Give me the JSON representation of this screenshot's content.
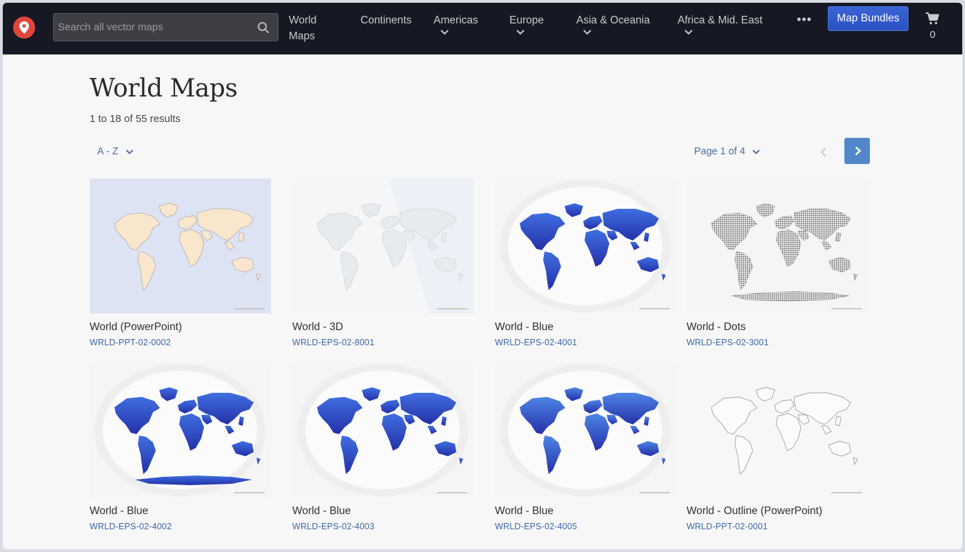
{
  "nav": {
    "search_placeholder": "Search all vector maps",
    "items": [
      {
        "label": "World\nMaps",
        "line1": "World",
        "line2": "Maps"
      },
      {
        "label": "Continents"
      },
      {
        "label": "Americas"
      },
      {
        "label": "Europe"
      },
      {
        "label": "Asia & Oceania"
      },
      {
        "label": "Africa & Mid. East"
      }
    ],
    "more": "•••",
    "bundles_label": "Map Bundles",
    "cart_count": "0"
  },
  "page": {
    "title": "World Maps",
    "results": "1 to 18 of 55 results",
    "sort_label": "A - Z",
    "page_label": "Page 1 of 4"
  },
  "products": [
    {
      "name": "World (PowerPoint)",
      "sku": "WRLD-PPT-02-0002",
      "style": "ppt"
    },
    {
      "name": "World - 3D",
      "sku": "WRLD-EPS-02-8001",
      "style": "3d"
    },
    {
      "name": "World - Blue",
      "sku": "WRLD-EPS-02-4001",
      "style": "blue"
    },
    {
      "name": "World - Dots",
      "sku": "WRLD-EPS-02-3001",
      "style": "dots"
    },
    {
      "name": "World - Blue",
      "sku": "WRLD-EPS-02-4002",
      "style": "blue-ant"
    },
    {
      "name": "World - Blue",
      "sku": "WRLD-EPS-02-4003",
      "style": "blue"
    },
    {
      "name": "World - Blue",
      "sku": "WRLD-EPS-02-4005",
      "style": "blue-green"
    },
    {
      "name": "World - Outline (PowerPoint)",
      "sku": "WRLD-PPT-02-0001",
      "style": "outline"
    }
  ],
  "colors": {
    "nav_bg": "#161923",
    "accent": "#2f5ad0",
    "link": "#3b66a8",
    "next_button": "#5288c9"
  }
}
